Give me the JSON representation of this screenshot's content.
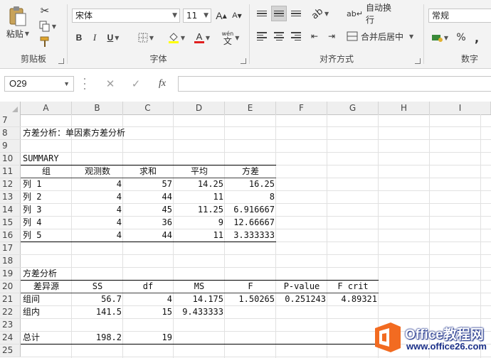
{
  "ribbon": {
    "clipboard": {
      "group": "剪贴板",
      "paste": "粘贴"
    },
    "font": {
      "group": "字体",
      "name": "宋体",
      "size": "11",
      "bold": "B",
      "italic": "I",
      "underline": "U",
      "grow": "A",
      "shrink": "A",
      "font_color": "A",
      "phonetic_top": "wén",
      "phonetic_bottom": "文"
    },
    "alignment": {
      "group": "对齐方式",
      "wrap": "自动换行",
      "merge": "合并后居中"
    },
    "number": {
      "group": "数字",
      "format": "常规",
      "percent": "%",
      "comma": ","
    }
  },
  "formula_bar": {
    "name_box": "O29",
    "fx": "fx",
    "formula": ""
  },
  "columns": [
    "A",
    "B",
    "C",
    "D",
    "E",
    "F",
    "G",
    "H",
    "I"
  ],
  "rows": [
    {
      "num": "7",
      "cells": []
    },
    {
      "num": "8",
      "cells": [
        {
          "col": "A",
          "text": "方差分析：单因素方差分析",
          "align": "l"
        }
      ]
    },
    {
      "num": "9",
      "cells": []
    },
    {
      "num": "10",
      "cells": [
        {
          "col": "A",
          "text": "SUMMARY",
          "align": "l"
        }
      ]
    },
    {
      "num": "11",
      "cells": [
        {
          "col": "A",
          "text": "组",
          "align": "c"
        },
        {
          "col": "B",
          "text": "观测数",
          "align": "c"
        },
        {
          "col": "C",
          "text": "求和",
          "align": "c"
        },
        {
          "col": "D",
          "text": "平均",
          "align": "c"
        },
        {
          "col": "E",
          "text": "方差",
          "align": "c"
        }
      ]
    },
    {
      "num": "12",
      "cells": [
        {
          "col": "A",
          "text": "列 1",
          "align": "l"
        },
        {
          "col": "B",
          "text": "4",
          "align": "r"
        },
        {
          "col": "C",
          "text": "57",
          "align": "r"
        },
        {
          "col": "D",
          "text": "14.25",
          "align": "r"
        },
        {
          "col": "E",
          "text": "16.25",
          "align": "r"
        }
      ]
    },
    {
      "num": "13",
      "cells": [
        {
          "col": "A",
          "text": "列 2",
          "align": "l"
        },
        {
          "col": "B",
          "text": "4",
          "align": "r"
        },
        {
          "col": "C",
          "text": "44",
          "align": "r"
        },
        {
          "col": "D",
          "text": "11",
          "align": "r"
        },
        {
          "col": "E",
          "text": "8",
          "align": "r"
        }
      ]
    },
    {
      "num": "14",
      "cells": [
        {
          "col": "A",
          "text": "列 3",
          "align": "l"
        },
        {
          "col": "B",
          "text": "4",
          "align": "r"
        },
        {
          "col": "C",
          "text": "45",
          "align": "r"
        },
        {
          "col": "D",
          "text": "11.25",
          "align": "r"
        },
        {
          "col": "E",
          "text": "6.916667",
          "align": "r"
        }
      ]
    },
    {
      "num": "15",
      "cells": [
        {
          "col": "A",
          "text": "列 4",
          "align": "l"
        },
        {
          "col": "B",
          "text": "4",
          "align": "r"
        },
        {
          "col": "C",
          "text": "36",
          "align": "r"
        },
        {
          "col": "D",
          "text": "9",
          "align": "r"
        },
        {
          "col": "E",
          "text": "12.66667",
          "align": "r"
        }
      ]
    },
    {
      "num": "16",
      "cells": [
        {
          "col": "A",
          "text": "列 5",
          "align": "l"
        },
        {
          "col": "B",
          "text": "4",
          "align": "r"
        },
        {
          "col": "C",
          "text": "44",
          "align": "r"
        },
        {
          "col": "D",
          "text": "11",
          "align": "r"
        },
        {
          "col": "E",
          "text": "3.333333",
          "align": "r"
        }
      ]
    },
    {
      "num": "17",
      "cells": []
    },
    {
      "num": "18",
      "cells": []
    },
    {
      "num": "19",
      "cells": [
        {
          "col": "A",
          "text": "方差分析",
          "align": "l"
        }
      ]
    },
    {
      "num": "20",
      "cells": [
        {
          "col": "A",
          "text": "差异源",
          "align": "c"
        },
        {
          "col": "B",
          "text": "SS",
          "align": "c"
        },
        {
          "col": "C",
          "text": "df",
          "align": "c"
        },
        {
          "col": "D",
          "text": "MS",
          "align": "c"
        },
        {
          "col": "E",
          "text": "F",
          "align": "c"
        },
        {
          "col": "F",
          "text": "P-value",
          "align": "c"
        },
        {
          "col": "G",
          "text": "F crit",
          "align": "c"
        }
      ]
    },
    {
      "num": "21",
      "cells": [
        {
          "col": "A",
          "text": "组间",
          "align": "l"
        },
        {
          "col": "B",
          "text": "56.7",
          "align": "r"
        },
        {
          "col": "C",
          "text": "4",
          "align": "r"
        },
        {
          "col": "D",
          "text": "14.175",
          "align": "r"
        },
        {
          "col": "E",
          "text": "1.50265",
          "align": "r"
        },
        {
          "col": "F",
          "text": "0.251243",
          "align": "r"
        },
        {
          "col": "G",
          "text": "4.89321",
          "align": "r"
        }
      ]
    },
    {
      "num": "22",
      "cells": [
        {
          "col": "A",
          "text": "组内",
          "align": "l"
        },
        {
          "col": "B",
          "text": "141.5",
          "align": "r"
        },
        {
          "col": "C",
          "text": "15",
          "align": "r"
        },
        {
          "col": "D",
          "text": "9.433333",
          "align": "r"
        }
      ]
    },
    {
      "num": "23",
      "cells": []
    },
    {
      "num": "24",
      "cells": [
        {
          "col": "A",
          "text": "总计",
          "align": "l"
        },
        {
          "col": "B",
          "text": "198.2",
          "align": "r"
        },
        {
          "col": "C",
          "text": "19",
          "align": "r"
        }
      ]
    },
    {
      "num": "25",
      "cells": []
    }
  ],
  "watermark": {
    "brand": "Office教程网",
    "url": "www.office26.com"
  },
  "colors": {
    "ribbon_bg": "#f3f3f3",
    "header_bg": "#efefef",
    "gridline": "#e1e1e1",
    "watermark_orange": "#f26b21",
    "watermark_blue": "#1a2f88"
  }
}
